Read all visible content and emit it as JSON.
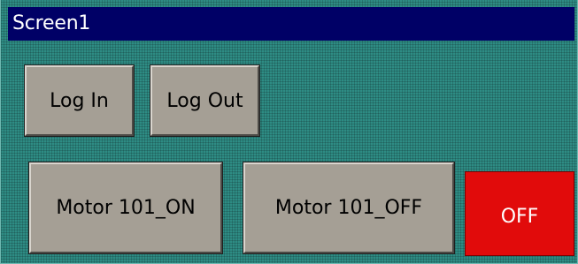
{
  "window": {
    "title": "Screen1"
  },
  "buttons": {
    "log_in": "Log In",
    "log_out": "Log Out",
    "motor_on": "Motor 101_ON",
    "motor_off": "Motor 101_OFF"
  },
  "motor_status": {
    "text": "OFF",
    "color": "#e10b0b"
  },
  "colors": {
    "background": "#2e8c84",
    "titlebar": "#000066",
    "button_face": "#a59f95"
  }
}
